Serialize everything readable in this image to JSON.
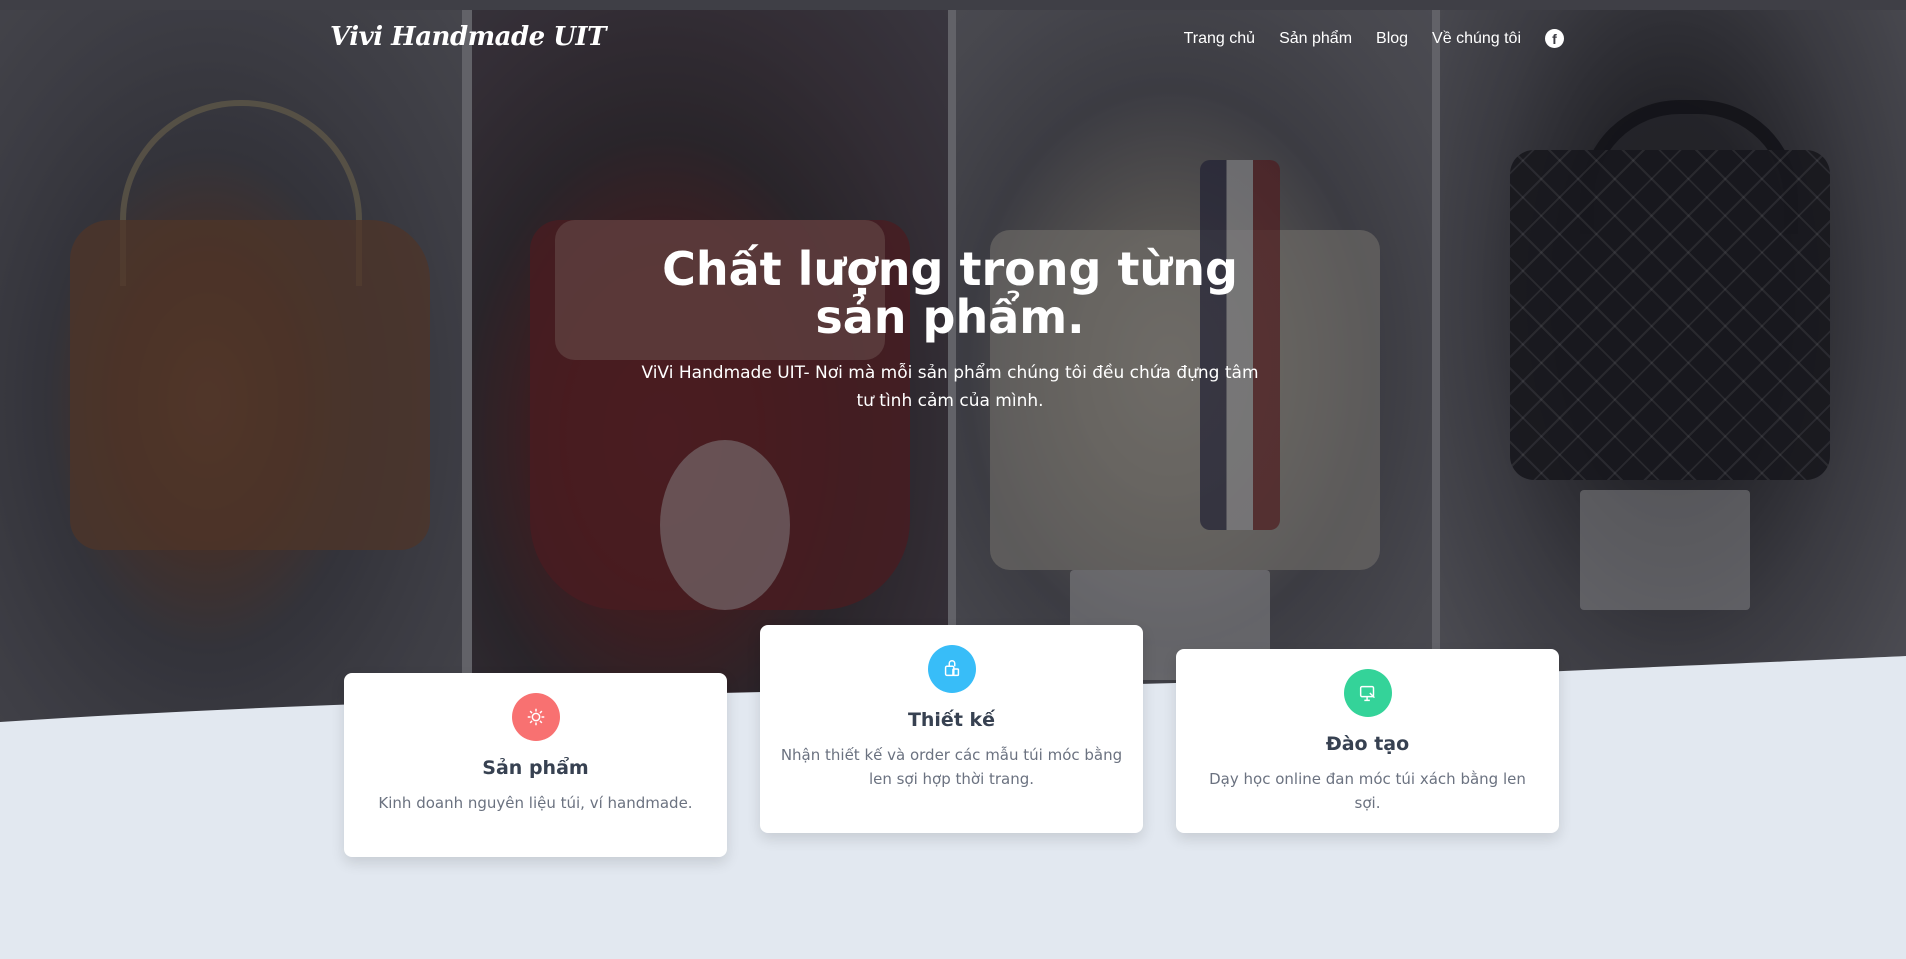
{
  "brand": "Vivi Handmade UIT",
  "nav": {
    "items": [
      "Trang chủ",
      "Sản phẩm",
      "Blog",
      "Về chúng tôi"
    ],
    "facebook_icon": "facebook-icon"
  },
  "hero": {
    "title": "Chất lượng trong từng sản phẩm.",
    "subtitle": "ViVi Handmade UIT- Nơi mà mỗi sản phẩm chúng tôi đều chứa đựng tâm tư tình cảm của mình."
  },
  "features": [
    {
      "title": "Sản phẩm",
      "description": "Kinh doanh nguyên liệu túi, ví handmade.",
      "icon": "product-icon",
      "color": "#f87171"
    },
    {
      "title": "Thiết kế",
      "description": "Nhận thiết kế và order các mẫu túi móc bằng len sợi hợp thời trang.",
      "icon": "design-icon",
      "color": "#38bdf8"
    },
    {
      "title": "Đào tạo",
      "description": "Dạy học online đan móc túi xách bằng len sợi.",
      "icon": "training-icon",
      "color": "#34d399"
    }
  ],
  "colors": {
    "background": "#e2e8f0",
    "card": "#ffffff",
    "text_dark": "#374151",
    "text_muted": "#6b7280"
  }
}
